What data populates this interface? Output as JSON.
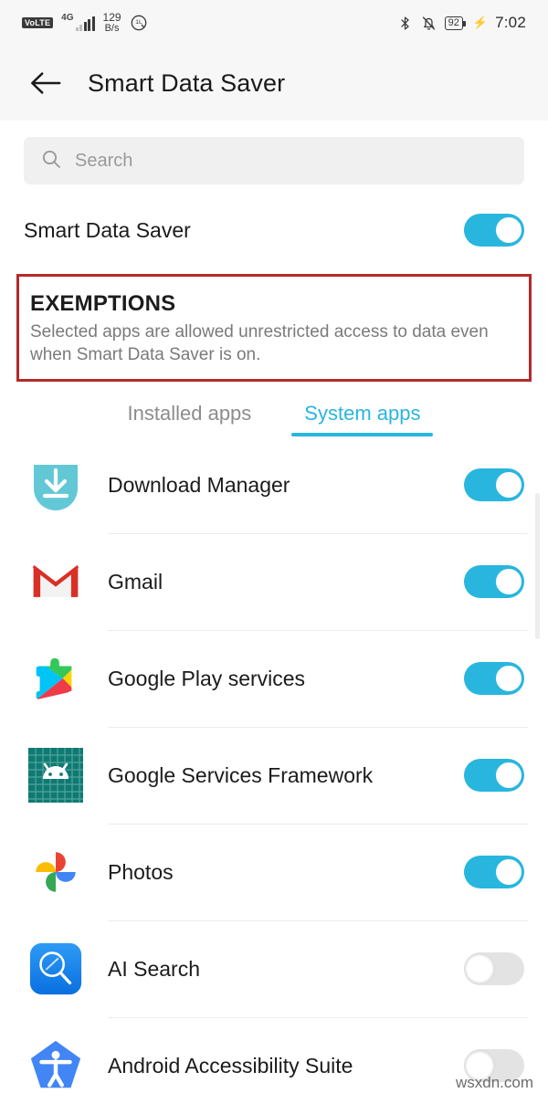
{
  "statusbar": {
    "volte_label": "VoLTE",
    "network_type": "4G",
    "net_speed_value": "129",
    "net_speed_unit": "B/s",
    "signal_icon": "signal-bars-icon",
    "data_saver_icon": "data-saver-icon",
    "bluetooth_icon": "bluetooth-icon",
    "mute_icon": "bell-muted-icon",
    "battery_level": "92",
    "charging_icon": "charging-bolt-icon",
    "time": "7:02"
  },
  "appbar": {
    "back_icon": "back-arrow-icon",
    "title": "Smart Data Saver"
  },
  "search": {
    "icon": "search-icon",
    "placeholder": "Search",
    "value": ""
  },
  "main_setting": {
    "label": "Smart Data Saver",
    "state": "on"
  },
  "exemptions": {
    "heading": "EXEMPTIONS",
    "description": "Selected apps are allowed unrestricted access to data even when Smart Data Saver is on.",
    "highlight_color": "#b52a2a"
  },
  "tabs": [
    {
      "label": "Installed apps",
      "active": false
    },
    {
      "label": "System apps",
      "active": true
    }
  ],
  "colors": {
    "accent": "#28b6de",
    "toggle_off": "#e3e3e3",
    "text_primary": "#1b1b1b",
    "text_secondary": "#7a7a7a"
  },
  "apps": [
    {
      "name": "Download Manager",
      "icon": "download-manager-icon",
      "state": "on"
    },
    {
      "name": "Gmail",
      "icon": "gmail-icon",
      "state": "on"
    },
    {
      "name": "Google Play services",
      "icon": "google-play-services-icon",
      "state": "on"
    },
    {
      "name": "Google Services Framework",
      "icon": "google-services-framework-icon",
      "state": "on"
    },
    {
      "name": "Photos",
      "icon": "google-photos-icon",
      "state": "on"
    },
    {
      "name": "AI Search",
      "icon": "ai-search-icon",
      "state": "off"
    },
    {
      "name": "Android Accessibility Suite",
      "icon": "android-accessibility-suite-icon",
      "state": "off"
    }
  ],
  "watermark": "wsxdn.com"
}
